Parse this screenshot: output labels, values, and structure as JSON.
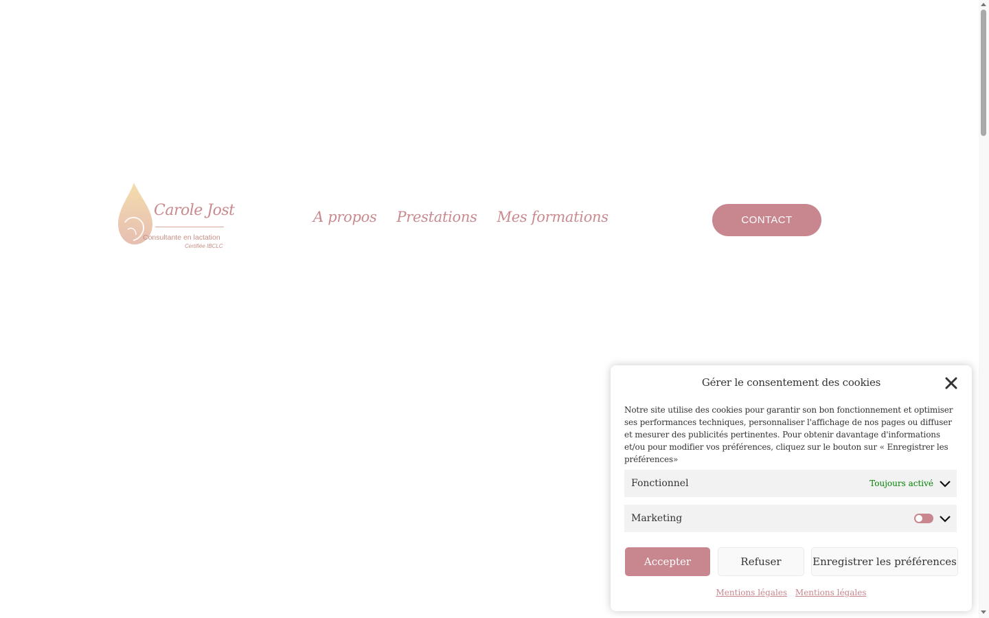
{
  "logo": {
    "name": "Carole Jost",
    "subtitle": "Consultante en lactation",
    "certification": "Certifiée IBCLC"
  },
  "nav": {
    "items": [
      "A propos",
      "Prestations",
      "Mes formations"
    ],
    "contact_label": "CONTACT"
  },
  "cookie_banner": {
    "title": "Gérer le consentement des cookies",
    "text": "Notre site utilise des cookies pour garantir son bon fonctionnement et optimiser ses performances techniques, personnaliser l'affichage de nos pages ou diffuser et mesurer des publicités pertinentes. Pour obtenir davantage d'informations et/ou pour modifier vos préférences, cliquez sur le bouton sur « Enregistrer les préférences»",
    "categories": [
      {
        "label": "Fonctionnel",
        "status": "Toujours activé"
      },
      {
        "label": "Marketing"
      }
    ],
    "accept_label": "Accepter",
    "refuse_label": "Refuser",
    "save_label": "Enregistrer les préférences",
    "links": [
      "Mentions légales",
      "Mentions légales"
    ]
  },
  "colors": {
    "accent": "#c8878f",
    "always_on": "#008000"
  }
}
